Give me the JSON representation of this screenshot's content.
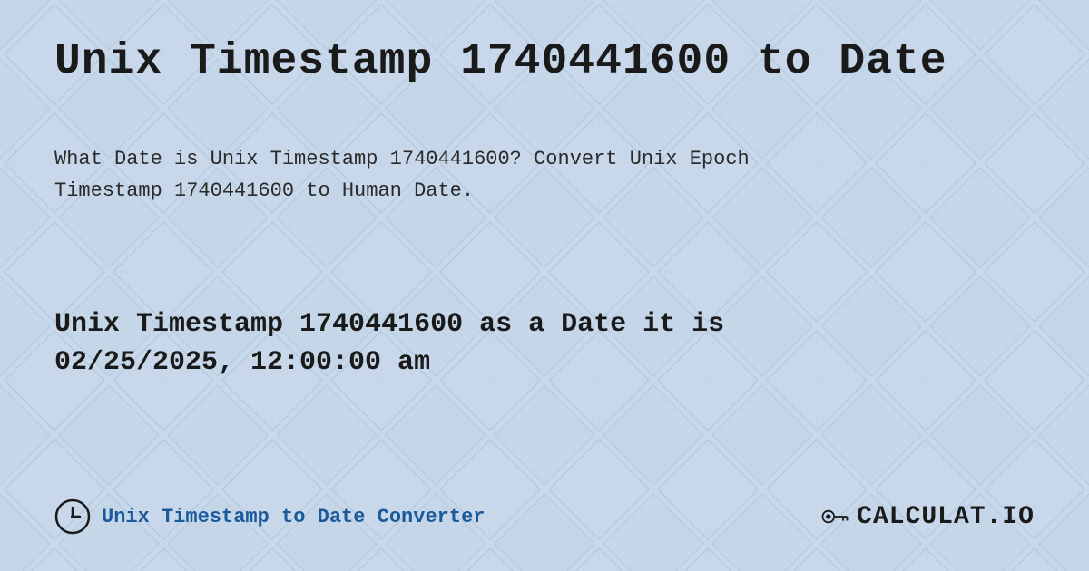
{
  "page": {
    "title": "Unix Timestamp 1740441600 to Date",
    "description_line1": "What Date is Unix Timestamp 1740441600? Convert Unix Epoch",
    "description_line2": "Timestamp 1740441600 to Human Date.",
    "result_line1": "Unix Timestamp 1740441600 as a Date it is",
    "result_line2": "02/25/2025, 12:00:00 am",
    "footer_link": "Unix Timestamp to Date Converter",
    "logo_text": "CALCULAT.IO",
    "background_color": "#c8d8e8",
    "accent_color": "#1a5a9a"
  }
}
